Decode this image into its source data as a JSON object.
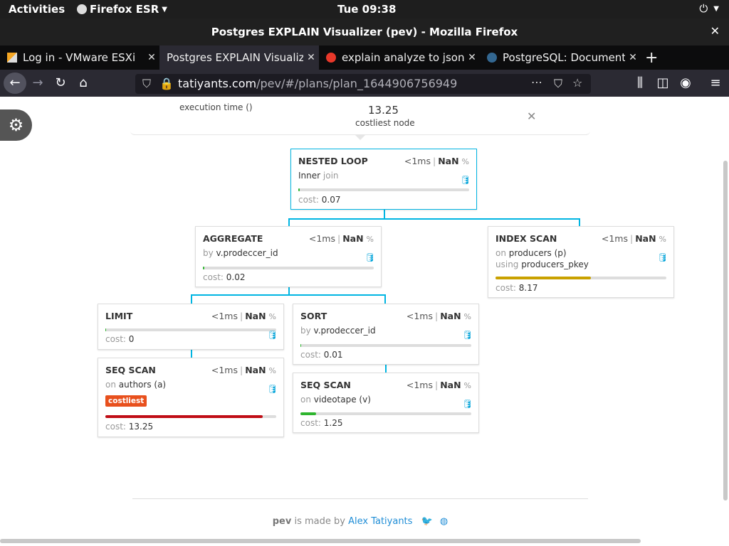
{
  "system": {
    "activities": "Activities",
    "app": "Firefox ESR",
    "clock": "Tue 09:38"
  },
  "window": {
    "title": "Postgres EXPLAIN Visualizer (pev) - Mozilla Firefox"
  },
  "tabs": [
    {
      "label": "Log in - VMware ESXi"
    },
    {
      "label": "Postgres EXPLAIN Visualizer"
    },
    {
      "label": "explain analyze to json"
    },
    {
      "label": "PostgreSQL: Documentation"
    }
  ],
  "url": {
    "host": "tatiyants.com",
    "path": "/pev/#/plans/plan_1644906756949"
  },
  "summary": {
    "exec_label": "execution time ()",
    "cost_value": "13.25",
    "cost_label": "costliest node"
  },
  "nodes": {
    "nested_loop": {
      "title": "NESTED LOOP",
      "time": "<1ms",
      "pct": "NaN",
      "pct_sign": "%",
      "l1a": "Inner",
      "l1b": "join",
      "cost_k": "cost:",
      "cost": "0.07",
      "fill": 0.01,
      "color": "#2eb52e"
    },
    "aggregate": {
      "title": "AGGREGATE",
      "time": "<1ms",
      "pct": "NaN",
      "pct_sign": "%",
      "l1a": "by",
      "l1b": "v.prodeccer_id",
      "cost_k": "cost:",
      "cost": "0.02",
      "fill": 0.01,
      "color": "#2eb52e"
    },
    "index_scan": {
      "title": "INDEX SCAN",
      "time": "<1ms",
      "pct": "NaN",
      "pct_sign": "%",
      "l1a": "on",
      "l1b": "producers (p)",
      "l2a": "using",
      "l2b": "producers_pkey",
      "cost_k": "cost:",
      "cost": "8.17",
      "fill": 0.56,
      "color": "#c9a100"
    },
    "limit": {
      "title": "LIMIT",
      "time": "<1ms",
      "pct": "NaN",
      "pct_sign": "%",
      "cost_k": "cost:",
      "cost": "0",
      "fill": 0.005,
      "color": "#2eb52e"
    },
    "sort": {
      "title": "SORT",
      "time": "<1ms",
      "pct": "NaN",
      "pct_sign": "%",
      "l1a": "by",
      "l1b": "v.prodeccer_id",
      "cost_k": "cost:",
      "cost": "0.01",
      "fill": 0.005,
      "color": "#2eb52e"
    },
    "seq_scan_a": {
      "title": "SEQ SCAN",
      "time": "<1ms",
      "pct": "NaN",
      "pct_sign": "%",
      "l1a": "on",
      "l1b": "authors (a)",
      "badge": "costliest",
      "cost_k": "cost:",
      "cost": "13.25",
      "fill": 0.92,
      "color": "#c00d15"
    },
    "seq_scan_v": {
      "title": "SEQ SCAN",
      "time": "<1ms",
      "pct": "NaN",
      "pct_sign": "%",
      "l1a": "on",
      "l1b": "videotape (v)",
      "cost_k": "cost:",
      "cost": "1.25",
      "fill": 0.09,
      "color": "#2eb52e"
    }
  },
  "footer": {
    "pev": "pev",
    "made_by": " is made by ",
    "author": "Alex Tatiyants"
  }
}
